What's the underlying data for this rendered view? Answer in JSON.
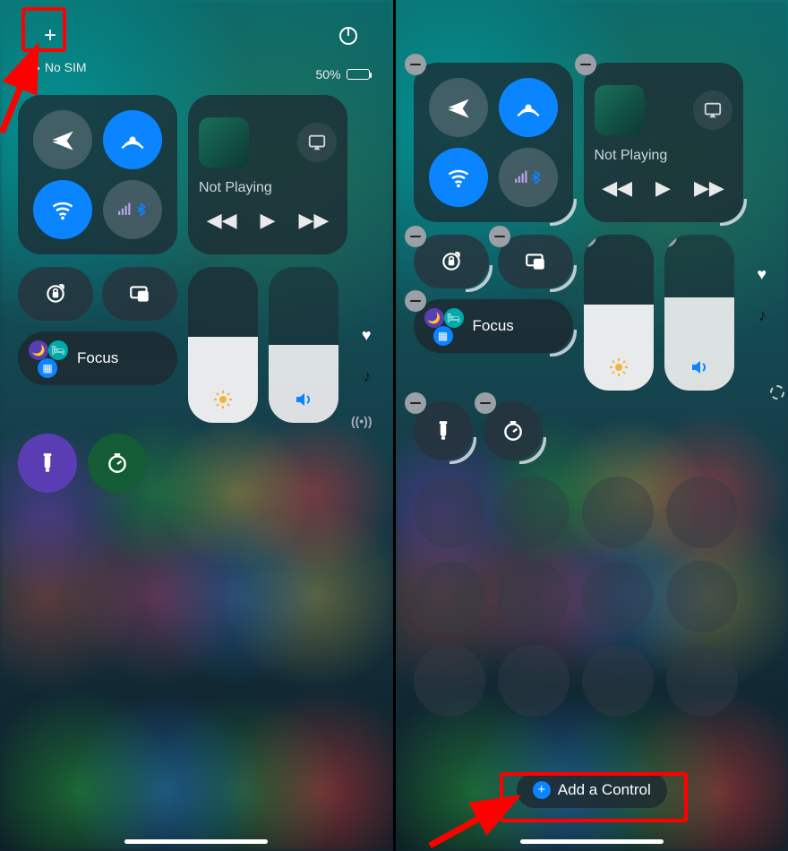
{
  "colors": {
    "accent": "#0a84ff",
    "highlight": "#ff0000"
  },
  "left": {
    "status": {
      "carrier": "No SIM",
      "battery_text": "50%",
      "battery_pct": 50
    },
    "media": {
      "title": "Not Playing"
    },
    "focus": {
      "label": "Focus"
    },
    "brightness_pct": 55,
    "volume_pct": 50,
    "icons": {
      "add": "add-icon",
      "power": "power-icon",
      "airplane": "airplane-icon",
      "airdrop": "airdrop-icon",
      "wifi": "wifi-icon",
      "cellular": "cellular-icon",
      "bluetooth": "bluetooth-icon",
      "lock": "orientation-lock-icon",
      "mirror": "screen-mirroring-icon",
      "flashlight": "flashlight-icon",
      "timer": "timer-icon",
      "heart": "heart-icon",
      "music_note": "music-note-icon",
      "hotspot": "hotspot-icon"
    }
  },
  "right": {
    "media": {
      "title": "Not Playing"
    },
    "focus": {
      "label": "Focus"
    },
    "brightness_pct": 55,
    "volume_pct": 60,
    "add_control_label": "Add a Control",
    "icons": {
      "airplane": "airplane-icon",
      "airdrop": "airdrop-icon",
      "wifi": "wifi-icon",
      "cellular": "cellular-icon",
      "bluetooth": "bluetooth-icon",
      "lock": "orientation-lock-icon",
      "mirror": "screen-mirroring-icon",
      "flashlight": "flashlight-icon",
      "timer": "timer-icon"
    }
  }
}
